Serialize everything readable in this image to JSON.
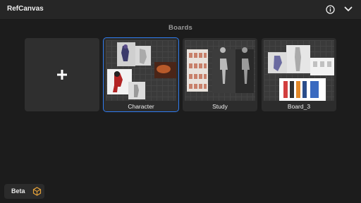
{
  "app": {
    "title": "RefCanvas"
  },
  "toolbar": {
    "info_icon": "info-circle-icon",
    "menu_icon": "chevron-down-icon"
  },
  "section": {
    "title": "Boards"
  },
  "boards": [
    {
      "label": "Character",
      "selected": true
    },
    {
      "label": "Study",
      "selected": false
    },
    {
      "label": "Board_3",
      "selected": false
    }
  ],
  "new_board": {
    "icon": "plus-icon"
  },
  "footer": {
    "beta_label": "Beta",
    "beta_icon": "hexagon-cube-icon"
  },
  "colors": {
    "accent": "#2f7cf0",
    "beta_icon": "#e8a43a",
    "background": "#1c1c1c"
  }
}
